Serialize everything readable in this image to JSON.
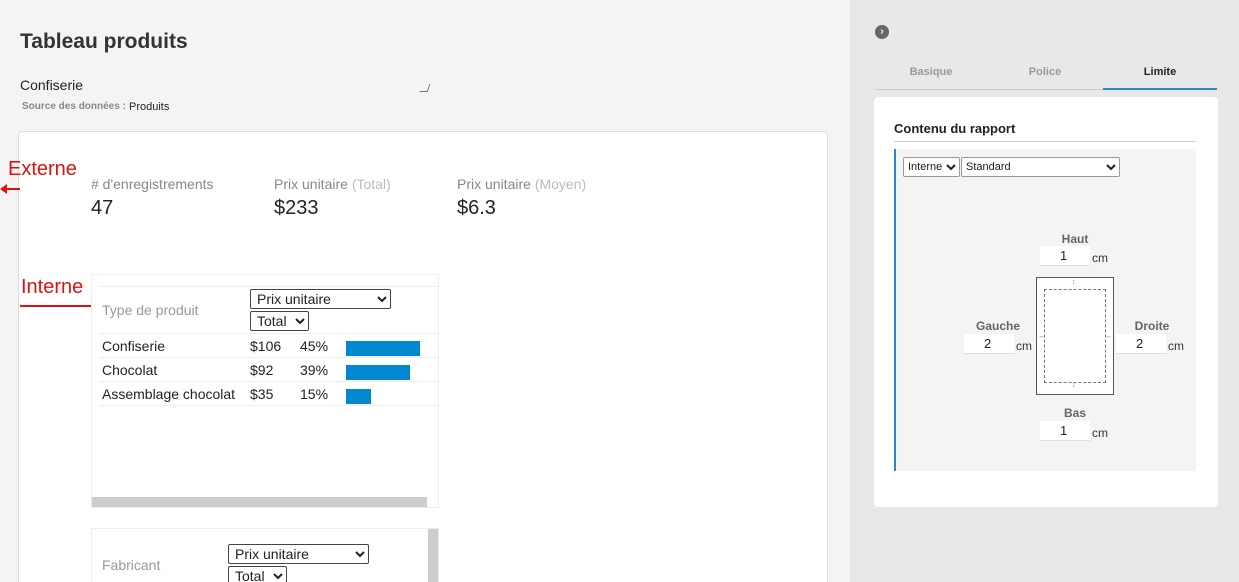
{
  "left": {
    "title": "Tableau produits",
    "subtitle_value": "Confiserie",
    "source_label": "Source des données :",
    "source_value": "Produits",
    "annotations": {
      "externe": "Externe",
      "interne": "Interne"
    },
    "kpis": [
      {
        "label": "# d'enregistrements",
        "suffix": "",
        "value": "47"
      },
      {
        "label": "Prix unitaire",
        "suffix": "(Total)",
        "value": "$233"
      },
      {
        "label": "Prix unitaire",
        "suffix": "(Moyen)",
        "value": "$6.3"
      }
    ],
    "card1": {
      "dimension": "Type de produit",
      "measure_select": "Prix unitaire",
      "agg_select": "Total",
      "rows": [
        {
          "name": "Confiserie",
          "value": "$106",
          "pct": "45%",
          "share": 45
        },
        {
          "name": "Chocolat",
          "value": "$92",
          "pct": "39%",
          "share": 39
        },
        {
          "name": "Assemblage chocolat",
          "value": "$35",
          "pct": "15%",
          "share": 15
        }
      ]
    },
    "card2": {
      "dimension": "Fabricant",
      "measure_select": "Prix unitaire",
      "agg_select": "Total"
    }
  },
  "right": {
    "nav_icon": "chevron-right-icon",
    "tabs": [
      {
        "label": "Basique",
        "active": false
      },
      {
        "label": "Police",
        "active": false
      },
      {
        "label": "Limite",
        "active": true
      }
    ],
    "panel_title": "Contenu du rapport",
    "scope_select": "Interne",
    "style_select": "Standard",
    "margins": {
      "top_label": "Haut",
      "top_value": "1",
      "left_label": "Gauche",
      "left_value": "2",
      "right_label": "Droite",
      "right_value": "2",
      "bottom_label": "Bas",
      "bottom_value": "1",
      "unit": "cm"
    }
  },
  "colors": {
    "accent": "#2a86d6",
    "bar": "#0288d1",
    "annotation": "#e01010"
  }
}
